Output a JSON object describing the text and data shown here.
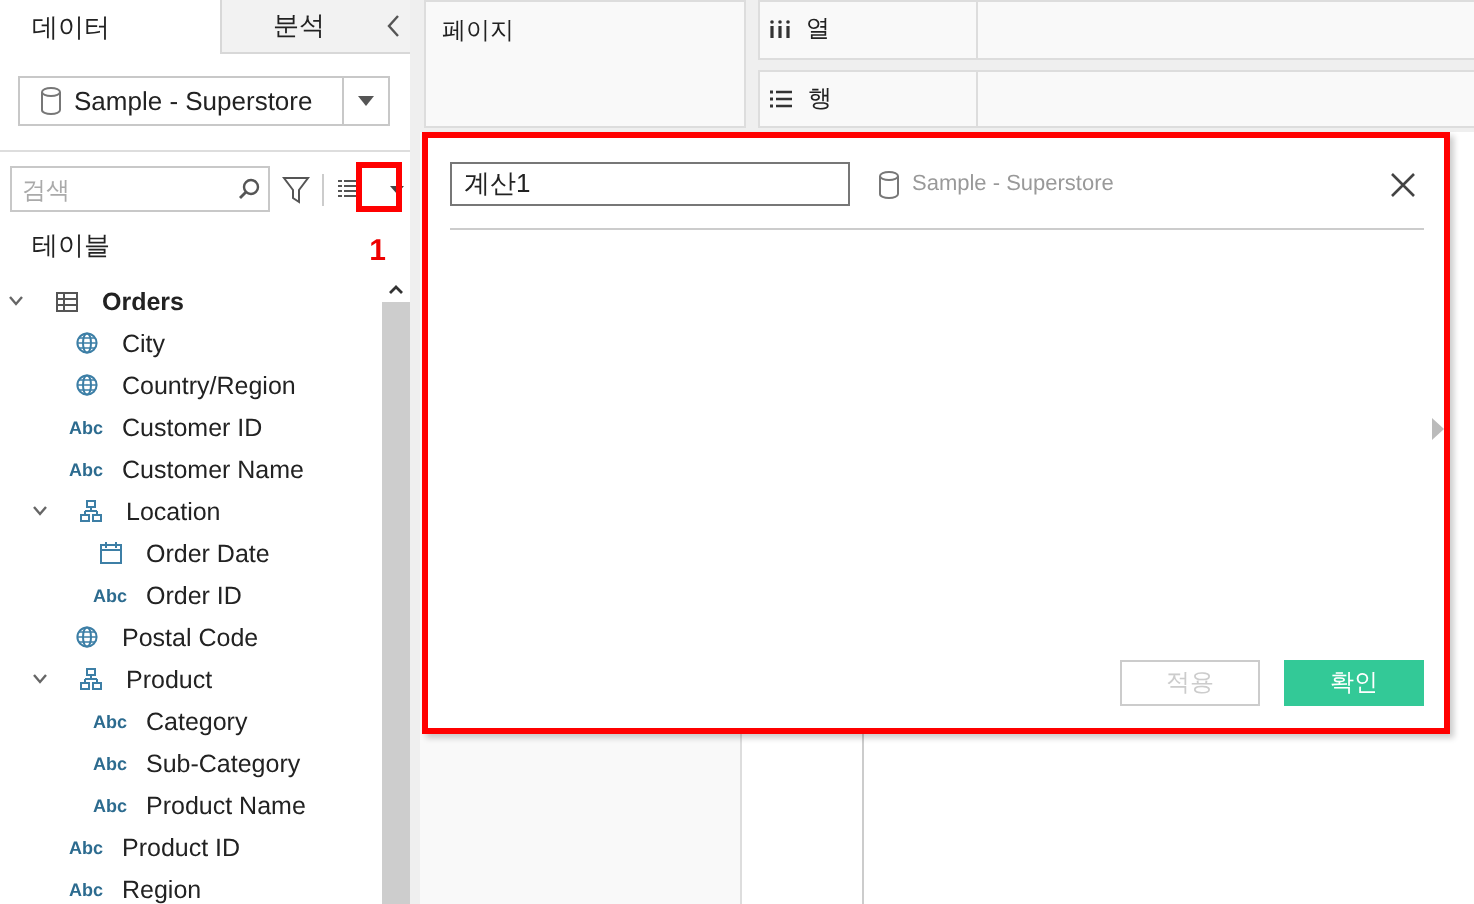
{
  "sidebar": {
    "tabs": [
      {
        "label": "데이터",
        "selected": true
      },
      {
        "label": "분석",
        "selected": false
      }
    ],
    "data_source": "Sample - Superstore",
    "search": {
      "placeholder": "검색"
    },
    "section_title": "테이블",
    "tree": [
      {
        "label": "Orders",
        "kind": "table",
        "expanded": true,
        "children": [
          {
            "label": "City",
            "kind": "geo"
          },
          {
            "label": "Country/Region",
            "kind": "geo"
          },
          {
            "label": "Customer ID",
            "kind": "text",
            "type_label": "Abc"
          },
          {
            "label": "Customer Name",
            "kind": "text",
            "type_label": "Abc"
          },
          {
            "label": "Location",
            "kind": "hierarchy",
            "expanded": true,
            "children": [
              {
                "label": "Order Date",
                "kind": "date"
              },
              {
                "label": "Order ID",
                "kind": "text",
                "type_label": "Abc"
              }
            ]
          },
          {
            "label": "Postal Code",
            "kind": "geo"
          },
          {
            "label": "Product",
            "kind": "hierarchy",
            "expanded": true,
            "children": [
              {
                "label": "Category",
                "kind": "text",
                "type_label": "Abc"
              },
              {
                "label": "Sub-Category",
                "kind": "text",
                "type_label": "Abc"
              },
              {
                "label": "Product Name",
                "kind": "text",
                "type_label": "Abc"
              }
            ]
          },
          {
            "label": "Product ID",
            "kind": "text",
            "type_label": "Abc"
          },
          {
            "label": "Region",
            "kind": "text",
            "type_label": "Abc"
          }
        ]
      }
    ]
  },
  "annotation": {
    "label": "1"
  },
  "shelves": {
    "pages": "페이지",
    "columns": "열",
    "rows": "행"
  },
  "calc_dialog": {
    "name": "계산1",
    "data_source": "Sample - Superstore",
    "buttons": [
      {
        "label": "적용",
        "disabled": true
      },
      {
        "label": "확인",
        "disabled": false
      }
    ]
  }
}
